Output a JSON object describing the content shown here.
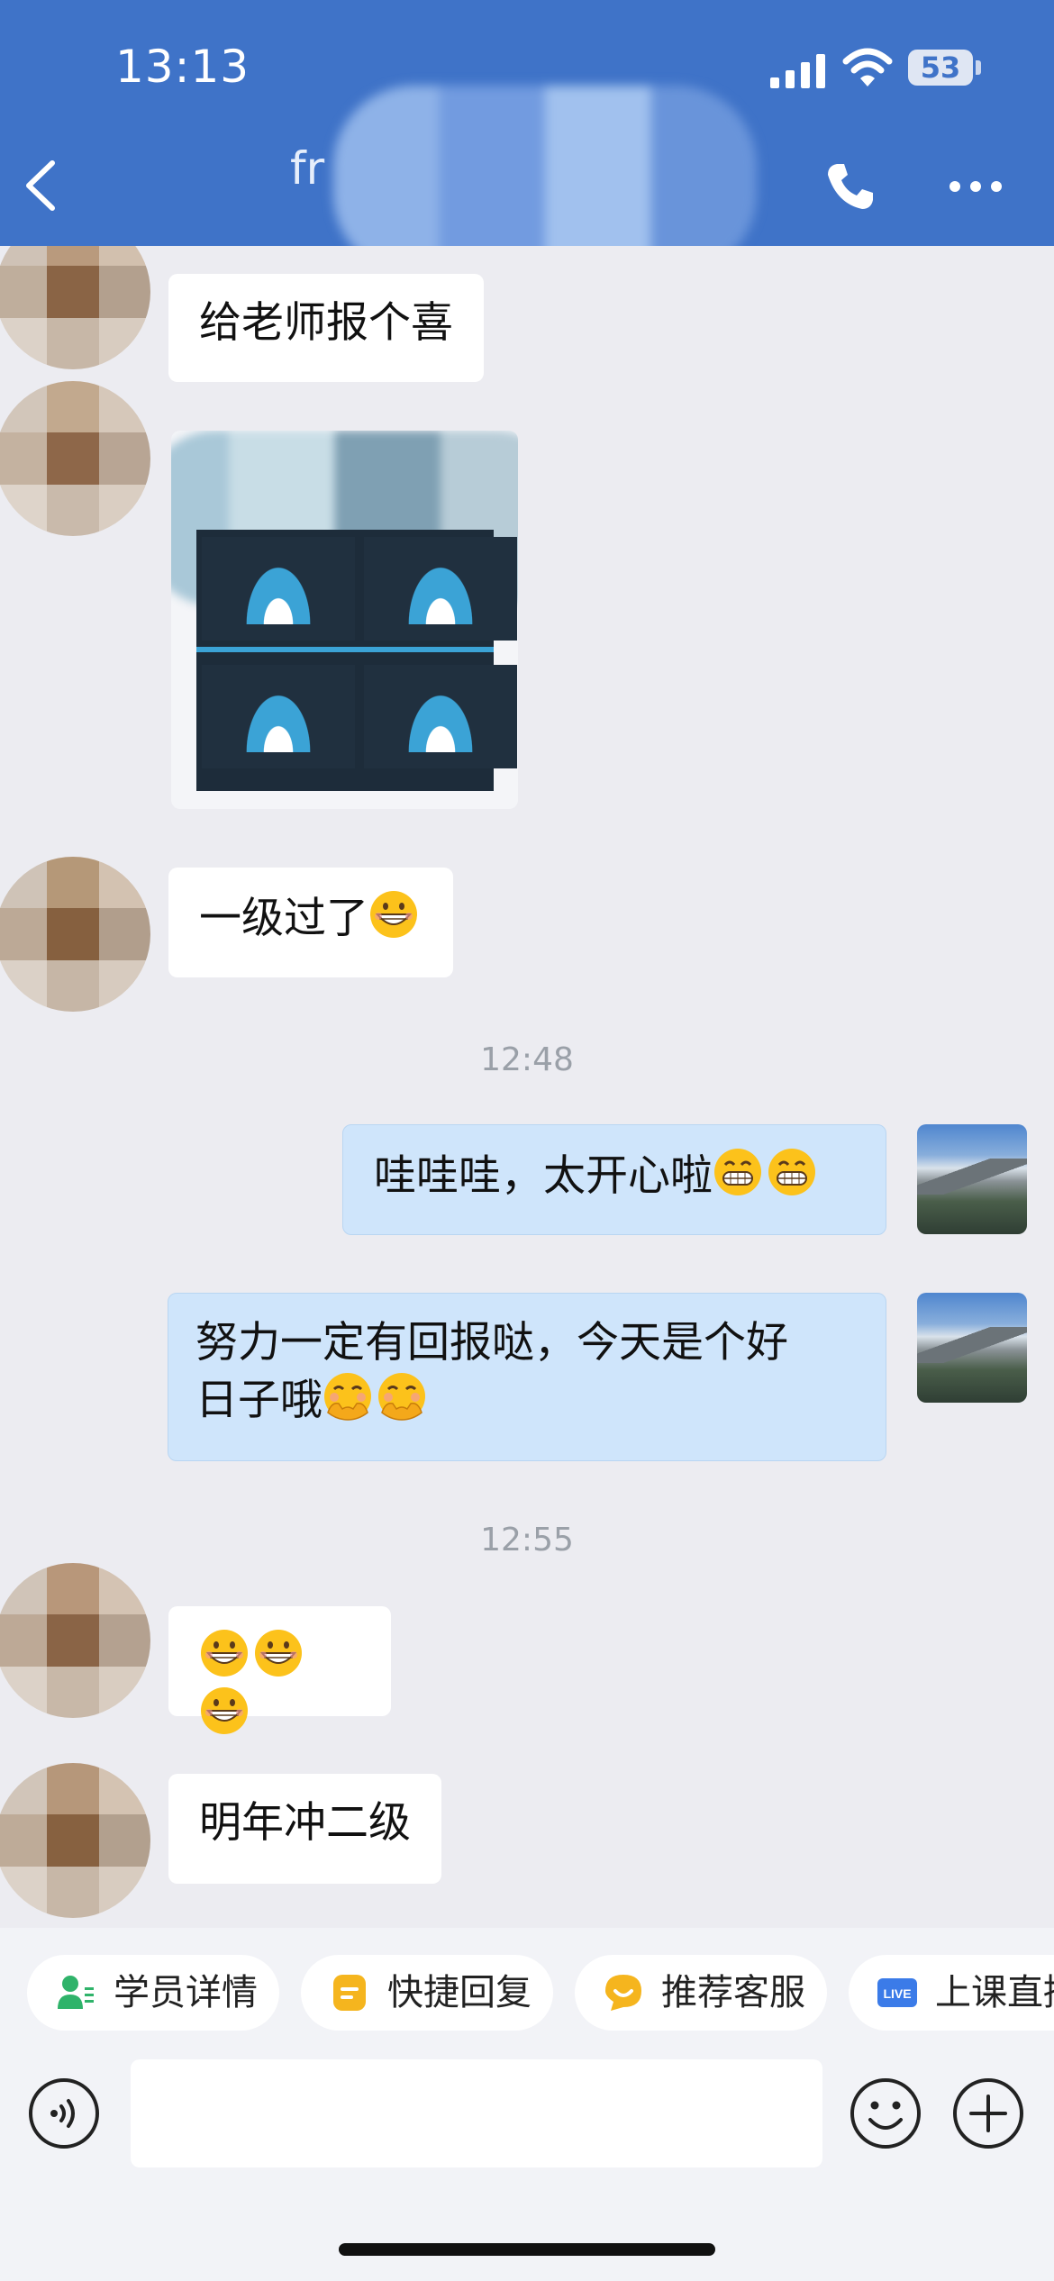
{
  "status_bar": {
    "time": "13:13",
    "battery": "53"
  },
  "header": {
    "contact_name_visible": "fr"
  },
  "messages": [
    {
      "text": "给老师报个喜"
    },
    {
      "text": "一级过了"
    },
    {
      "time": "12:48"
    },
    {
      "text": "哇哇哇，太开心啦"
    },
    {
      "text_line1": "努力一定有回报哒，今天是个好",
      "text_line2": "日子哦"
    },
    {
      "time": "12:55"
    },
    {
      "text": ""
    },
    {
      "text": "明年冲二级"
    }
  ],
  "quick_actions": [
    {
      "label": "学员详情",
      "icon": "student-detail-icon",
      "color": "#2fb36a"
    },
    {
      "label": "快捷回复",
      "icon": "quick-reply-icon",
      "color": "#f5b51e"
    },
    {
      "label": "推荐客服",
      "icon": "recommend-service-icon",
      "color": "#f5b51e"
    },
    {
      "label": "上课直播",
      "icon": "live-icon",
      "color": "#3b7be8",
      "badge": "LIVE"
    }
  ],
  "input": {
    "placeholder": ""
  },
  "colors": {
    "header": "#3f73c8",
    "incoming_bubble": "#ffffff",
    "outgoing_bubble": "#cfe5fb",
    "background": "#ececf1"
  }
}
